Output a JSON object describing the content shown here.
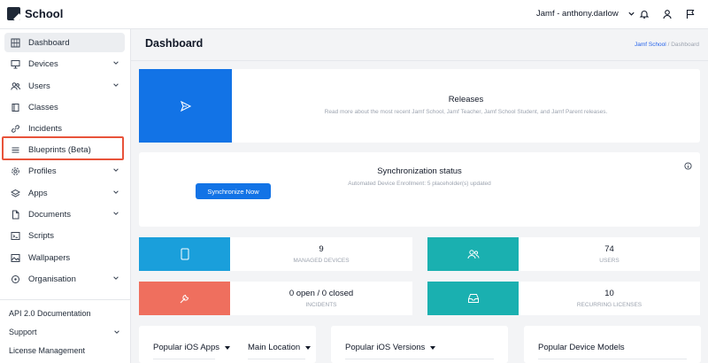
{
  "app": {
    "name": "School"
  },
  "header": {
    "user": "Jamf - anthony.darlow"
  },
  "sidebar": {
    "items": [
      {
        "label": "Dashboard",
        "icon": "grid-icon",
        "expandable": false
      },
      {
        "label": "Devices",
        "icon": "monitor-icon",
        "expandable": true
      },
      {
        "label": "Users",
        "icon": "users-icon",
        "expandable": true
      },
      {
        "label": "Classes",
        "icon": "book-icon",
        "expandable": false
      },
      {
        "label": "Incidents",
        "icon": "link-icon",
        "expandable": false
      },
      {
        "label": "Blueprints (Beta)",
        "icon": "list-icon",
        "expandable": false
      },
      {
        "label": "Profiles",
        "icon": "gear-icon",
        "expandable": true
      },
      {
        "label": "Apps",
        "icon": "layers-icon",
        "expandable": true
      },
      {
        "label": "Documents",
        "icon": "document-icon",
        "expandable": true
      },
      {
        "label": "Scripts",
        "icon": "terminal-icon",
        "expandable": false
      },
      {
        "label": "Wallpapers",
        "icon": "image-icon",
        "expandable": false
      },
      {
        "label": "Organisation",
        "icon": "target-icon",
        "expandable": true
      }
    ],
    "footer": {
      "api": "API 2.0 Documentation",
      "support": "Support",
      "license": "License Management"
    }
  },
  "main": {
    "title": "Dashboard",
    "breadcrumb": {
      "home": "Jamf School",
      "separator": "/",
      "current": "Dashboard"
    },
    "releases": {
      "title": "Releases",
      "subtitle": "Read more about the most recent Jamf School, Jamf Teacher, Jamf School Student, and Jamf Parent releases."
    },
    "sync": {
      "title": "Synchronization status",
      "subtitle": "Automated Device Enrollment: 5 placeholder(s) updated",
      "button": "Synchronize Now"
    },
    "stats": {
      "devices": {
        "value": "9",
        "label": "MANAGED DEVICES",
        "color": "#1a9fdb"
      },
      "users": {
        "value": "74",
        "label": "USERS",
        "color": "#1ab0b0"
      },
      "incidents": {
        "value": "0 open / 0 closed",
        "label": "INCIDENTS",
        "color": "#ef6f5e"
      },
      "licenses": {
        "value": "10",
        "label": "RECURRING LICENSES",
        "color": "#1ab0b0"
      }
    },
    "panels": {
      "ios_apps": "Popular iOS Apps",
      "location": "Main Location",
      "ios_versions": "Popular iOS Versions",
      "device_models": "Popular Device Models"
    }
  },
  "colors": {
    "accent": "#1273e6",
    "highlight": "#e8533a"
  }
}
